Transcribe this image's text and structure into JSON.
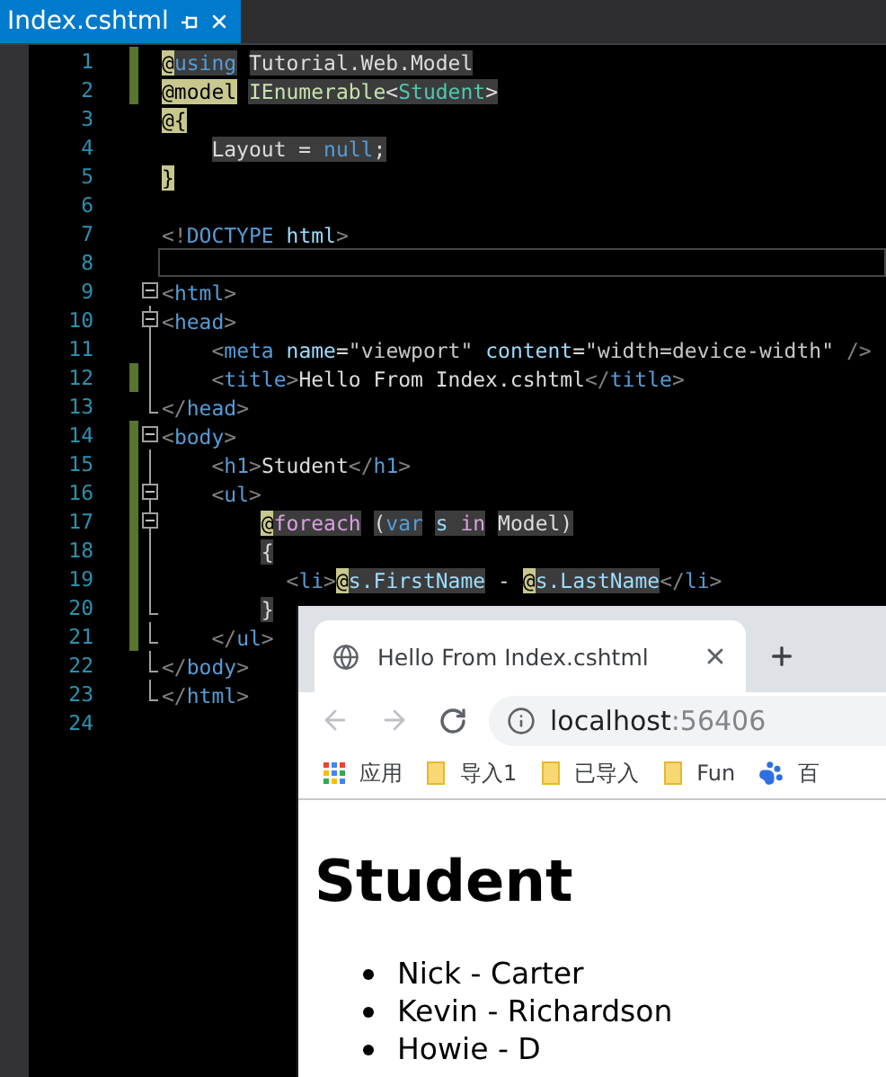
{
  "editor_tab": {
    "title": "Index.cshtml",
    "selected": true
  },
  "lines": [
    {
      "number": "1",
      "modified": true,
      "current": false,
      "tokens": [
        {
          "text": "@",
          "kind": "razor",
          "shaded": false
        },
        {
          "text": "using",
          "kind": "keyword",
          "shaded": true
        },
        {
          "text": " Tutorial.Web.Model",
          "kind": "plain",
          "shaded": true
        }
      ]
    },
    {
      "number": "2",
      "modified": true,
      "current": false,
      "tokens": [
        {
          "text": "@model",
          "kind": "razor",
          "shaded": false
        },
        {
          "text": " IEnumerable",
          "kind": "typename",
          "shaded": true
        },
        {
          "text": "<",
          "kind": "plain",
          "shaded": true
        },
        {
          "text": "Student",
          "kind": "type",
          "shaded": true
        },
        {
          "text": ">",
          "kind": "plain",
          "shaded": true
        }
      ]
    },
    {
      "number": "3",
      "modified": false,
      "current": false,
      "tokens": [
        {
          "text": "@{",
          "kind": "razor",
          "shaded": false
        }
      ]
    },
    {
      "number": "4",
      "modified": false,
      "current": false,
      "tokens": [
        {
          "text": "    Layout = ",
          "kind": "plain",
          "shaded": true
        },
        {
          "text": "null",
          "kind": "keyword",
          "shaded": true
        },
        {
          "text": ";",
          "kind": "plain",
          "shaded": true
        }
      ]
    },
    {
      "number": "5",
      "modified": false,
      "current": false,
      "tokens": [
        {
          "text": "}",
          "kind": "razor",
          "shaded": false
        }
      ]
    },
    {
      "number": "6",
      "modified": false,
      "current": false
    },
    {
      "number": "7",
      "modified": false,
      "current": false,
      "tokens": [
        {
          "text": "<!",
          "kind": "bracket",
          "shaded": false
        },
        {
          "text": "DOCTYPE",
          "kind": "tag",
          "shaded": false
        },
        {
          "text": " html",
          "kind": "attr",
          "shaded": false
        },
        {
          "text": ">",
          "kind": "bracket",
          "shaded": false
        }
      ]
    },
    {
      "number": "8",
      "modified": false,
      "current": true
    },
    {
      "number": "9",
      "modified": false,
      "current": false,
      "fold": {
        "kind": "start"
      },
      "tokens": [
        {
          "text": "<",
          "kind": "bracket",
          "shaded": false
        },
        {
          "text": "html",
          "kind": "tag",
          "shaded": false
        },
        {
          "text": ">",
          "kind": "bracket",
          "shaded": false
        }
      ]
    },
    {
      "number": "10",
      "modified": false,
      "current": false,
      "fold": {
        "kind": "start"
      },
      "tokens": [
        {
          "text": "<",
          "kind": "bracket",
          "shaded": false
        },
        {
          "text": "head",
          "kind": "tag",
          "shaded": false
        },
        {
          "text": ">",
          "kind": "bracket",
          "shaded": false
        }
      ]
    },
    {
      "number": "11",
      "modified": false,
      "current": false,
      "fold": {
        "kind": "line"
      },
      "tokens": [
        {
          "text": "    <",
          "kind": "bracket",
          "shaded": false
        },
        {
          "text": "meta",
          "kind": "tag",
          "shaded": false
        },
        {
          "text": " name",
          "kind": "attr",
          "shaded": false
        },
        {
          "text": "=",
          "kind": "plain",
          "shaded": false
        },
        {
          "text": "\"viewport\"",
          "kind": "string",
          "shaded": false
        },
        {
          "text": " content",
          "kind": "attr",
          "shaded": false
        },
        {
          "text": "=",
          "kind": "plain",
          "shaded": false
        },
        {
          "text": "\"width=device-width\"",
          "kind": "string",
          "shaded": false
        },
        {
          "text": " />",
          "kind": "bracket",
          "shaded": false
        }
      ]
    },
    {
      "number": "12",
      "modified": true,
      "current": false,
      "fold": {
        "kind": "line"
      },
      "tokens": [
        {
          "text": "    <",
          "kind": "bracket",
          "shaded": false
        },
        {
          "text": "title",
          "kind": "tag",
          "shaded": false
        },
        {
          "text": ">",
          "kind": "bracket",
          "shaded": false
        },
        {
          "text": "Hello From Index.cshtml",
          "kind": "plain",
          "shaded": false
        },
        {
          "text": "</",
          "kind": "bracket",
          "shaded": false
        },
        {
          "text": "title",
          "kind": "tag",
          "shaded": false
        },
        {
          "text": ">",
          "kind": "bracket",
          "shaded": false
        }
      ]
    },
    {
      "number": "13",
      "modified": false,
      "current": false,
      "fold": {
        "kind": "end"
      },
      "tokens": [
        {
          "text": "</",
          "kind": "bracket",
          "shaded": false
        },
        {
          "text": "head",
          "kind": "tag",
          "shaded": false
        },
        {
          "text": ">",
          "kind": "bracket",
          "shaded": false
        }
      ]
    },
    {
      "number": "14",
      "modified": true,
      "current": false,
      "fold": {
        "kind": "start"
      },
      "tokens": [
        {
          "text": "<",
          "kind": "bracket",
          "shaded": false
        },
        {
          "text": "body",
          "kind": "tag",
          "shaded": false
        },
        {
          "text": ">",
          "kind": "bracket",
          "shaded": false
        }
      ]
    },
    {
      "number": "15",
      "modified": true,
      "current": false,
      "fold": {
        "kind": "line"
      },
      "tokens": [
        {
          "text": "    <",
          "kind": "bracket",
          "shaded": false
        },
        {
          "text": "h1",
          "kind": "tag",
          "shaded": false
        },
        {
          "text": ">",
          "kind": "bracket",
          "shaded": false
        },
        {
          "text": "Student",
          "kind": "plain",
          "shaded": false
        },
        {
          "text": "</",
          "kind": "bracket",
          "shaded": false
        },
        {
          "text": "h1",
          "kind": "tag",
          "shaded": false
        },
        {
          "text": ">",
          "kind": "bracket",
          "shaded": false
        }
      ]
    },
    {
      "number": "16",
      "modified": true,
      "current": false,
      "fold": {
        "kind": "start"
      },
      "tokens": [
        {
          "text": "    <",
          "kind": "bracket",
          "shaded": false
        },
        {
          "text": "ul",
          "kind": "tag",
          "shaded": false
        },
        {
          "text": ">",
          "kind": "bracket",
          "shaded": false
        }
      ]
    },
    {
      "number": "17",
      "modified": true,
      "current": false,
      "fold": {
        "kind": "start"
      },
      "tokens": [
        {
          "text": "        @",
          "kind": "razor",
          "shaded": false
        },
        {
          "text": "foreach",
          "kind": "control",
          "shaded": true
        },
        {
          "text": " (",
          "kind": "plain",
          "shaded": true
        },
        {
          "text": "var",
          "kind": "keyword",
          "shaded": true
        },
        {
          "text": " s ",
          "kind": "attr",
          "shaded": true
        },
        {
          "text": "in",
          "kind": "control",
          "shaded": true
        },
        {
          "text": " Model)",
          "kind": "plain",
          "shaded": true
        }
      ]
    },
    {
      "number": "18",
      "modified": true,
      "current": false,
      "fold": {
        "kind": "line"
      },
      "tokens": [
        {
          "text": "        {",
          "kind": "plain",
          "shaded": true
        }
      ]
    },
    {
      "number": "19",
      "modified": true,
      "current": false,
      "fold": {
        "kind": "line"
      },
      "tokens": [
        {
          "text": "          <",
          "kind": "bracket",
          "shaded": false
        },
        {
          "text": "li",
          "kind": "tag",
          "shaded": false
        },
        {
          "text": ">",
          "kind": "bracket",
          "shaded": false
        },
        {
          "text": "@",
          "kind": "razor",
          "shaded": false
        },
        {
          "text": "s.FirstName",
          "kind": "attr",
          "shaded": true
        },
        {
          "text": " - ",
          "kind": "plain",
          "shaded": false
        },
        {
          "text": "@",
          "kind": "razor",
          "shaded": false
        },
        {
          "text": "s.LastName",
          "kind": "attr",
          "shaded": true
        },
        {
          "text": "</",
          "kind": "bracket",
          "shaded": false
        },
        {
          "text": "li",
          "kind": "tag",
          "shaded": false
        },
        {
          "text": ">",
          "kind": "bracket",
          "shaded": false
        }
      ]
    },
    {
      "number": "20",
      "modified": true,
      "current": false,
      "fold": {
        "kind": "end"
      },
      "tokens": [
        {
          "text": "        }",
          "kind": "plain",
          "shaded": true
        }
      ]
    },
    {
      "number": "21",
      "modified": true,
      "current": false,
      "fold": {
        "kind": "end"
      },
      "tokens": [
        {
          "text": "    </",
          "kind": "bracket",
          "shaded": false
        },
        {
          "text": "ul",
          "kind": "tag",
          "shaded": false
        },
        {
          "text": ">",
          "kind": "bracket",
          "shaded": false
        }
      ]
    },
    {
      "number": "22",
      "modified": false,
      "current": false,
      "fold": {
        "kind": "end"
      },
      "tokens": [
        {
          "text": "</",
          "kind": "bracket",
          "shaded": false
        },
        {
          "text": "body",
          "kind": "tag",
          "shaded": false
        },
        {
          "text": ">",
          "kind": "bracket",
          "shaded": false
        }
      ]
    },
    {
      "number": "23",
      "modified": false,
      "current": false,
      "fold": {
        "kind": "end"
      },
      "tokens": [
        {
          "text": "</",
          "kind": "bracket",
          "shaded": false
        },
        {
          "text": "html",
          "kind": "tag",
          "shaded": false
        },
        {
          "text": ">",
          "kind": "bracket",
          "shaded": false
        }
      ]
    },
    {
      "number": "24",
      "modified": false,
      "current": false
    }
  ],
  "browser": {
    "tab": {
      "title": "Hello From Index.cshtml",
      "selected": true
    },
    "address": {
      "host": "localhost",
      "port": ":56406"
    },
    "back_disabled": true,
    "forward_disabled": true,
    "bookmarks": [
      {
        "label": "应用",
        "kind": "apps"
      },
      {
        "label": "导入1",
        "kind": "folder"
      },
      {
        "label": "已导入",
        "kind": "folder"
      },
      {
        "label": "Fun",
        "kind": "folder"
      },
      {
        "label": "百",
        "kind": "paw"
      }
    ],
    "page": {
      "heading": "Student",
      "items": [
        "Nick - Carter",
        "Kevin - Richardson",
        "Howie - D"
      ]
    }
  }
}
